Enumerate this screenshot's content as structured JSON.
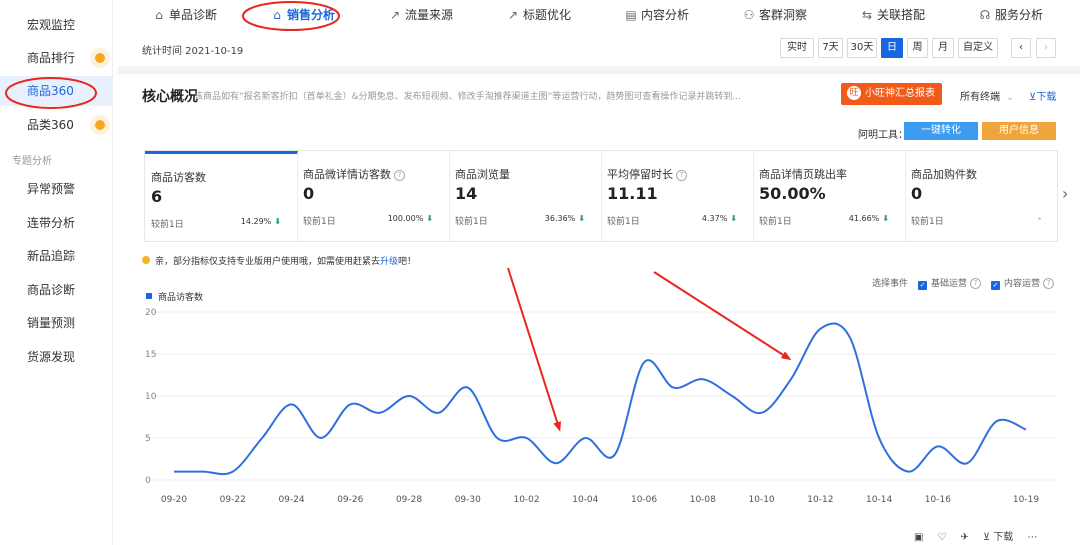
{
  "sidebar": {
    "items": [
      {
        "label": "宏观监控",
        "active": false
      },
      {
        "label": "商品排行",
        "active": false,
        "dot": true
      },
      {
        "label": "商品360",
        "active": true
      },
      {
        "label": "品类360",
        "active": false,
        "dot": true
      }
    ],
    "section_title": "专题分析",
    "section_items": [
      "异常预警",
      "连带分析",
      "新品追踪",
      "商品诊断",
      "销量预测",
      "货源发现"
    ]
  },
  "tabs": [
    {
      "label": "单品诊断",
      "icon": "bag-icon"
    },
    {
      "label": "销售分析",
      "icon": "bag-icon",
      "active": true
    },
    {
      "label": "流量来源",
      "icon": "trend-icon"
    },
    {
      "label": "标题优化",
      "icon": "trend-icon"
    },
    {
      "label": "内容分析",
      "icon": "doc-icon"
    },
    {
      "label": "客群洞察",
      "icon": "users-icon"
    },
    {
      "label": "关联搭配",
      "icon": "link-icon"
    },
    {
      "label": "服务分析",
      "icon": "headset-icon"
    }
  ],
  "stat": {
    "time_label": "统计时间 2021-10-19",
    "periods": [
      "实时",
      "7天",
      "30天",
      "日",
      "周",
      "月",
      "自定义"
    ],
    "active_period": "日",
    "prev": "‹",
    "next": "›"
  },
  "core": {
    "title": "核心概况",
    "desc": "该商品如有“报名新客折扣（首单礼金）&分期免息、发布短视频、修改手淘推荐渠道主图”等运营行动，趋势图可查看操作记录并跳转到...",
    "xiaowang_btn": "小旺神汇总报表",
    "xiaowang_icon_char": "旺",
    "terminal": "所有终端",
    "download": "⊻下载",
    "tools_label": "阿明工具：",
    "tool_buttons": [
      {
        "label": "一键转化",
        "color": "#3d9bf0"
      },
      {
        "label": "用户信息",
        "color": "#f0a43c"
      }
    ]
  },
  "metrics": [
    {
      "name": "商品访客数",
      "value": "6",
      "compare": "较前1日",
      "pct": "14.29%",
      "arrow": "⬇",
      "help": false
    },
    {
      "name": "商品微详情访客数",
      "value": "0",
      "compare": "较前1日",
      "pct": "100.00%",
      "arrow": "⬇",
      "help": true
    },
    {
      "name": "商品浏览量",
      "value": "14",
      "compare": "较前1日",
      "pct": "36.36%",
      "arrow": "⬇",
      "help": false
    },
    {
      "name": "平均停留时长",
      "value": "11.11",
      "compare": "较前1日",
      "pct": "4.37%",
      "arrow": "⬇",
      "help": true
    },
    {
      "name": "商品详情页跳出率",
      "value": "50.00%",
      "compare": "较前1日",
      "pct": "41.66%",
      "arrow": "⬇",
      "help": false
    },
    {
      "name": "商品加购件数",
      "value": "0",
      "compare": "较前1日",
      "pct": "-",
      "arrow": "",
      "help": false
    }
  ],
  "metrics_next": "›",
  "notice": {
    "text": "亲，部分指标仅支持专业版用户使用哦，如需使用赶紧去",
    "link": "升级",
    "suffix": "吧！"
  },
  "events": {
    "label": "选择事件",
    "options": [
      {
        "label": "基础运营",
        "checked": true
      },
      {
        "label": "内容运营",
        "checked": true
      }
    ]
  },
  "chart_data": {
    "type": "line",
    "series": [
      {
        "name": "商品访客数",
        "color": "#2f6fdd"
      }
    ],
    "x": [
      "09-20",
      "09-21",
      "09-22",
      "09-23",
      "09-24",
      "09-25",
      "09-26",
      "09-27",
      "09-28",
      "09-29",
      "09-30",
      "10-01",
      "10-02",
      "10-03",
      "10-04",
      "10-05",
      "10-06",
      "10-07",
      "10-08",
      "10-09",
      "10-10",
      "10-11",
      "10-12",
      "10-13",
      "10-14",
      "10-15",
      "10-16",
      "10-17",
      "10-18",
      "10-19"
    ],
    "y": [
      1,
      1,
      1,
      5,
      9,
      5,
      9,
      8,
      10,
      8,
      11,
      5,
      5,
      2,
      5,
      3,
      14,
      11,
      12,
      10,
      8,
      12,
      18,
      17,
      5,
      1,
      4,
      2,
      7,
      6
    ],
    "xticks": [
      "09-20",
      "09-22",
      "09-24",
      "09-26",
      "09-28",
      "09-30",
      "10-02",
      "10-04",
      "10-06",
      "10-08",
      "10-10",
      "10-12",
      "10-14",
      "10-16",
      "10-19"
    ],
    "yticks": [
      0,
      5,
      10,
      15,
      20
    ],
    "ylim": [
      0,
      20
    ],
    "grid": true,
    "legend": "top-left"
  },
  "annotations": {
    "circle_color": "#e8261c",
    "arrow_color": "#e8261c"
  },
  "bottombar": [
    "▣",
    "♡",
    "✈",
    "⊻ 下载",
    "⋯"
  ]
}
